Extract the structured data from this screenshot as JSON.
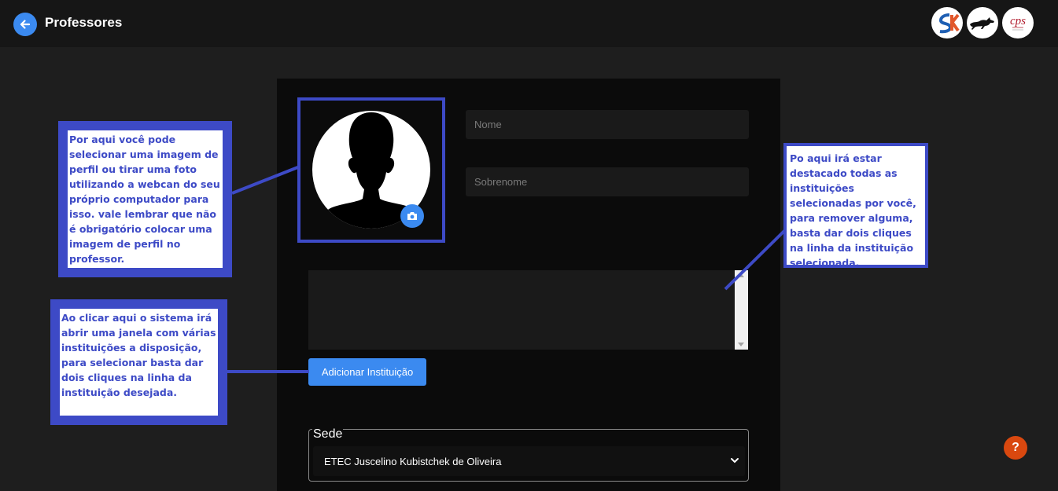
{
  "header": {
    "title": "Professores",
    "back_icon": "arrow-left-icon",
    "logos": [
      {
        "name": "SK"
      },
      {
        "name": "horse"
      },
      {
        "name": "cps"
      }
    ]
  },
  "form": {
    "nome_placeholder": "Nome",
    "sobrenome_placeholder": "Sobrenome",
    "add_institution_label": "Adicionar Instituição",
    "sede_legend": "Sede",
    "sede_value": "ETEC Juscelino Kubistchek de Oliveira"
  },
  "callouts": {
    "photo": "Por aqui você pode selecionar uma imagem de perfil ou tirar uma foto utilizando a webcan do seu próprio computador para isso. vale lembrar que não é obrigatório colocar uma imagem de perfil no professor.",
    "add_button": "Ao clicar aqui o sistema irá abrir uma janela com várias instituições a disposição, para selecionar basta dar dois cliques na linha da instituição desejada.",
    "institution_list": "Po aqui irá estar destacado todas as instituições selecionadas por você, para remover alguma, basta dar dois cliques na linha da instituição selecionada."
  },
  "help": {
    "label": "?"
  },
  "colors": {
    "accent": "#3b8af0",
    "callout_border": "#3d4ac6",
    "help": "#d9480f"
  }
}
